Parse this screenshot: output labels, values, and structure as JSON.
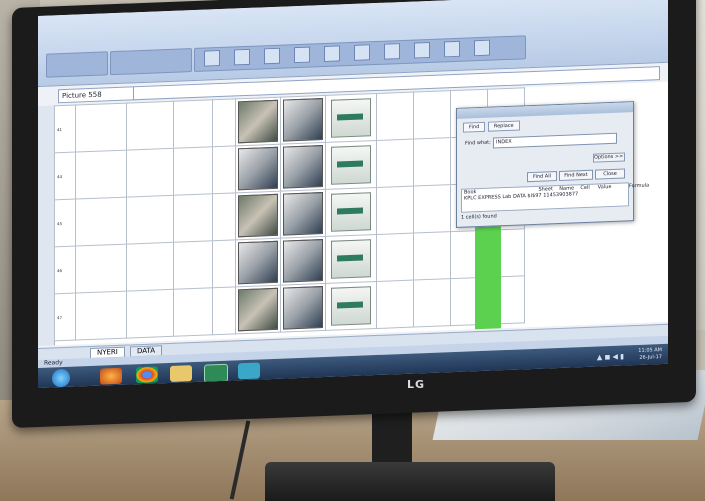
{
  "monitor": {
    "brand": "LG"
  },
  "excel": {
    "namebox": "Picture 558",
    "sheet_tabs": [
      "NYERI",
      "DATA"
    ],
    "status": "Ready",
    "dialog": {
      "tabs": [
        "Find",
        "Replace"
      ],
      "find_label": "Find what:",
      "find_value": "INDEX",
      "options_label": "Options >>",
      "buttons": [
        "Find All",
        "Find Next",
        "Close"
      ],
      "result_headers": [
        "Book",
        "Sheet",
        "Name",
        "Cell",
        "Value",
        "Formula"
      ],
      "result_row": "KPLC EXPRESS Lab  DATA  $I$97  11453903877",
      "status": "1 cell(s) found"
    },
    "rows": [
      {
        "num": "41",
        "name": "",
        "loc": "",
        "region": ""
      },
      {
        "num": "44",
        "name": "",
        "loc": "",
        "region": ""
      },
      {
        "num": "45",
        "name": "",
        "loc": "",
        "region": ""
      },
      {
        "num": "46",
        "name": "",
        "loc": "",
        "region": ""
      },
      {
        "num": "47",
        "name": "",
        "loc": "",
        "region": ""
      }
    ]
  },
  "taskbar": {
    "apps": [
      "windows-start",
      "firefox",
      "chrome",
      "file-explorer",
      "excel",
      "misc-app"
    ],
    "time": "11:05 AM",
    "date": "26-Jul-17"
  },
  "colors": {
    "highlight_column": "#5bd14f",
    "ribbon": "#b8cbe6",
    "taskbar": "#1d3252"
  }
}
